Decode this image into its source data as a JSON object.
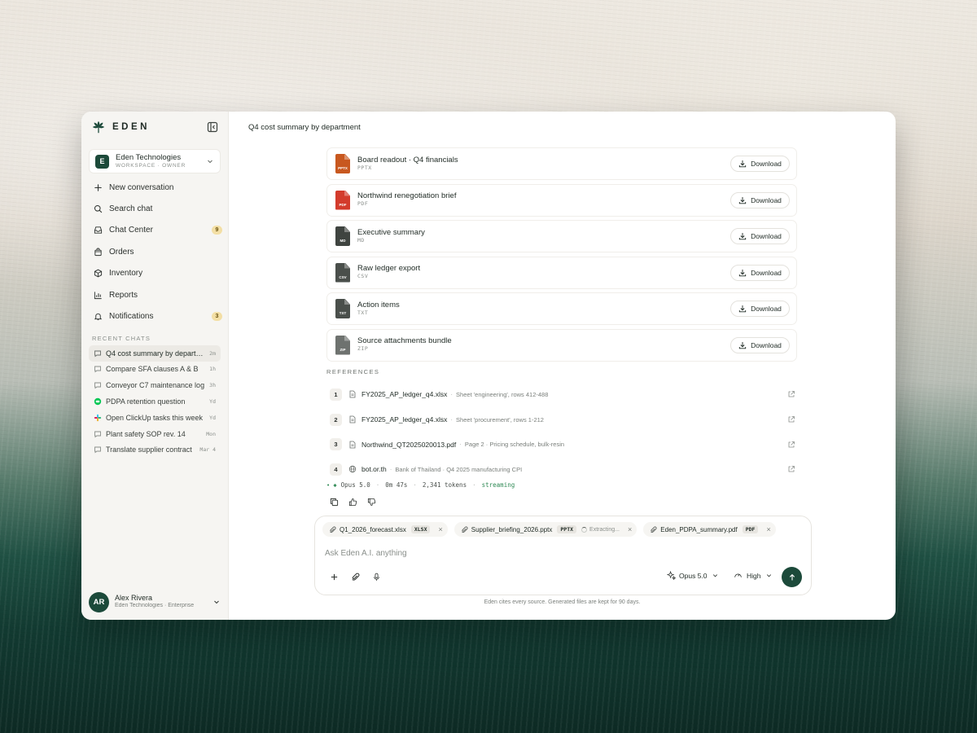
{
  "brand": {
    "name": "EDEN",
    "logo_icon": "leaf-logo-icon"
  },
  "workspace": {
    "initial": "E",
    "name": "Eden Technologies",
    "subtitle": "WORKSPACE · OWNER"
  },
  "nav": [
    {
      "label": "New conversation",
      "icon": "plus-icon"
    },
    {
      "label": "Search chat",
      "icon": "search-icon"
    },
    {
      "label": "Chat Center",
      "icon": "inbox-icon",
      "badge": "9"
    },
    {
      "label": "Orders",
      "icon": "bag-icon"
    },
    {
      "label": "Inventory",
      "icon": "box-icon"
    },
    {
      "label": "Reports",
      "icon": "bar-chart-icon"
    },
    {
      "label": "Notifications",
      "icon": "bell-icon",
      "badge": "3"
    }
  ],
  "recent_label": "RECENT CHATS",
  "recent_chats": [
    {
      "label": "Q4 cost summary by department",
      "time": "2m",
      "icon": "chat-icon",
      "active": true
    },
    {
      "label": "Compare SFA clauses A & B",
      "time": "1h",
      "icon": "chat-icon"
    },
    {
      "label": "Conveyor C7 maintenance log",
      "time": "3h",
      "icon": "chat-icon"
    },
    {
      "label": "PDPA retention question",
      "time": "Yd",
      "icon": "line-app-icon"
    },
    {
      "label": "Open ClickUp tasks this week",
      "time": "Yd",
      "icon": "slack-icon"
    },
    {
      "label": "Plant safety SOP rev. 14",
      "time": "Mon",
      "icon": "chat-icon"
    },
    {
      "label": "Translate supplier contract",
      "time": "Mar 4",
      "icon": "chat-icon"
    }
  ],
  "user": {
    "initials": "AR",
    "name": "Alex Rivera",
    "org": "Eden Technologies · Enterprise"
  },
  "conversation_title": "Q4 cost summary by department",
  "files": [
    {
      "name": "Board readout · Q4 financials",
      "type": "PPTX",
      "ext": "PPTX",
      "color": "#c8581f"
    },
    {
      "name": "Northwind renegotiation brief",
      "type": "PDF",
      "ext": "PDF",
      "color": "#d33b2c"
    },
    {
      "name": "Executive summary",
      "type": "MD",
      "ext": "MD",
      "color": "#3f4440"
    },
    {
      "name": "Raw ledger export",
      "type": "CSV",
      "ext": "CSV",
      "color": "#4a4f4b"
    },
    {
      "name": "Action items",
      "type": "TXT",
      "ext": "TXT",
      "color": "#4a4f4b"
    },
    {
      "name": "Source attachments bundle",
      "type": "ZIP",
      "ext": "ZIP",
      "color": "#6e726f"
    }
  ],
  "download_label": "Download",
  "references_label": "REFERENCES",
  "references": [
    {
      "num": "1",
      "name": "FY2025_AP_ledger_q4.xlsx",
      "desc": "Sheet 'engineering', rows 412-488",
      "icon": "file-icon"
    },
    {
      "num": "2",
      "name": "FY2025_AP_ledger_q4.xlsx",
      "desc": "Sheet 'procurement', rows 1-212",
      "icon": "file-icon"
    },
    {
      "num": "3",
      "name": "Northwind_QT2025020013.pdf",
      "desc": "Page 2 · Pricing schedule, bulk-resin",
      "icon": "file-icon"
    },
    {
      "num": "4",
      "name": "bot.or.th",
      "desc": "Bank of Thailand · Q4 2025 manufacturing CPI",
      "icon": "globe-icon"
    }
  ],
  "meta": {
    "model": "Opus 5.0",
    "duration": "0m 47s",
    "tokens": "2,341 tokens",
    "status": "streaming"
  },
  "attachments": [
    {
      "name": "Q1_2026_forecast.xlsx",
      "ext": "XLSX"
    },
    {
      "name": "Supplier_briefing_2026.pptx",
      "ext": "PPTX",
      "status": "Extracting..."
    },
    {
      "name": "Eden_PDPA_summary.pdf",
      "ext": "PDF"
    }
  ],
  "composer": {
    "placeholder": "Ask Eden A.I. anything",
    "model": "Opus 5.0",
    "effort": "High"
  },
  "footer_note": "Eden cites every source. Generated files are kept for 90 days.",
  "colors": {
    "accent": "#1c4a3a",
    "badge": "#f3dfa5",
    "streaming": "#2f8a55"
  }
}
